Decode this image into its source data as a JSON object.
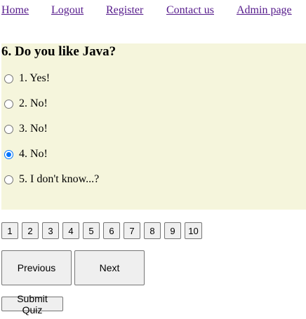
{
  "nav": {
    "links": [
      "Home",
      "Logout",
      "Register",
      "Contact us",
      "Admin page"
    ]
  },
  "question": {
    "title": "6. Do you like Java?",
    "selected_index": 3,
    "options": [
      "1. Yes!",
      "2. No!",
      "3. No!",
      "4. No!",
      "5. I don't know...?"
    ],
    "background_color": "#f5f5dc"
  },
  "pagination": {
    "pages": [
      "1",
      "2",
      "3",
      "4",
      "5",
      "6",
      "7",
      "8",
      "9",
      "10"
    ]
  },
  "controls": {
    "previous_label": "Previous",
    "next_label": "Next",
    "submit_label": "Submit Quiz"
  },
  "colors": {
    "link": "#551a8b",
    "radio_accent": "#0075ff"
  }
}
